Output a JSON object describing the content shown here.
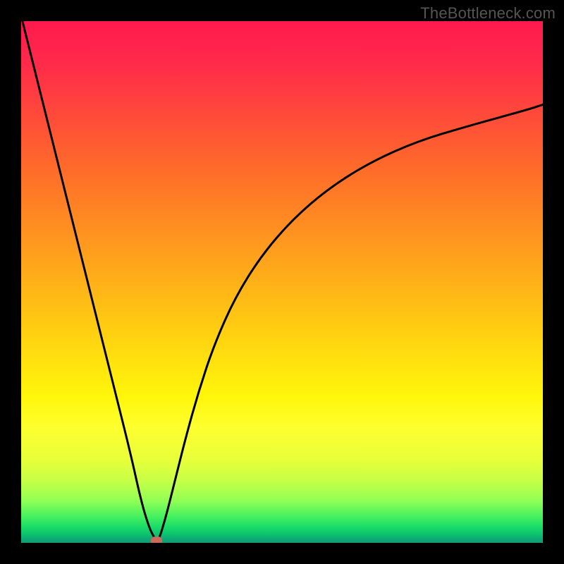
{
  "watermark": "TheBottleneck.com",
  "chart_data": {
    "type": "line",
    "title": "",
    "xlabel": "",
    "ylabel": "",
    "xlim": [
      0,
      100
    ],
    "ylim": [
      0,
      100
    ],
    "grid": false,
    "legend": false,
    "series": [
      {
        "name": "curve",
        "x": [
          0,
          3,
          6,
          9,
          12,
          15,
          18,
          21,
          23,
          24.5,
          25.5,
          26,
          26.5,
          27,
          28,
          29.5,
          31.5,
          34,
          37,
          41,
          46,
          52,
          59,
          67,
          76,
          86,
          97,
          100
        ],
        "y": [
          101,
          89,
          77,
          65,
          53,
          41,
          29,
          17,
          8,
          3,
          1,
          0.4,
          1,
          2.5,
          6,
          12,
          20,
          29,
          38,
          47,
          55,
          62,
          68,
          73,
          77,
          80,
          83,
          84
        ]
      }
    ],
    "minimum_marker": {
      "x": 26,
      "y": 0.4
    },
    "background_gradient": {
      "orientation": "vertical",
      "stops": [
        {
          "pos": 0.0,
          "color": "#ff1a4d"
        },
        {
          "pos": 0.28,
          "color": "#ff6a2a"
        },
        {
          "pos": 0.58,
          "color": "#ffca12"
        },
        {
          "pos": 0.78,
          "color": "#fdff2f"
        },
        {
          "pos": 0.92,
          "color": "#90ff55"
        },
        {
          "pos": 1.0,
          "color": "#129a76"
        }
      ]
    }
  }
}
